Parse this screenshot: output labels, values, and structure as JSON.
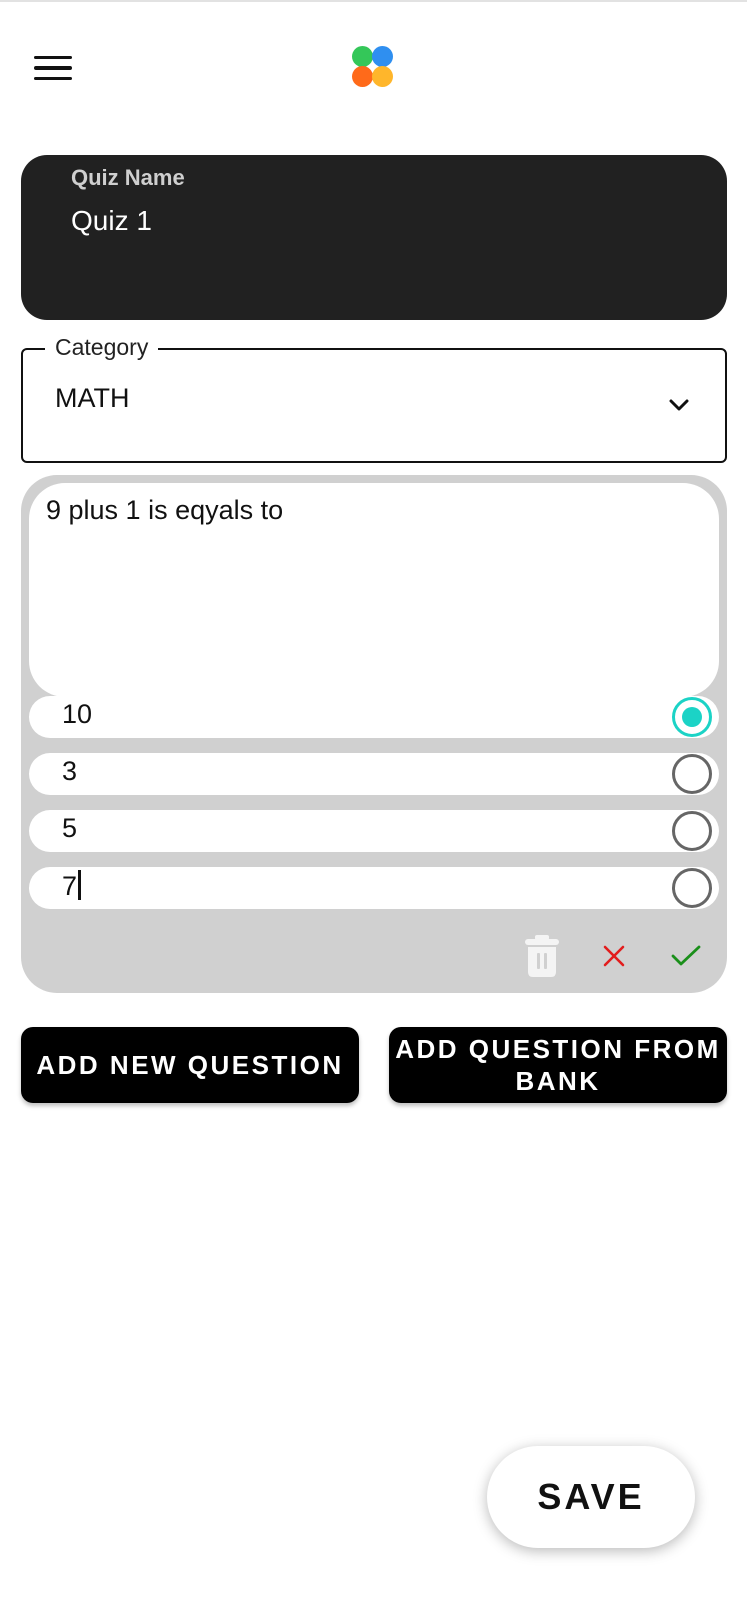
{
  "header": {
    "menu_icon": "hamburger-menu-icon",
    "logo_icon": "four-dot-logo-icon"
  },
  "quiz_name": {
    "label": "Quiz Name",
    "value": "Quiz 1"
  },
  "category": {
    "label": "Category",
    "selected": "MATH"
  },
  "question": {
    "text": "9 plus 1 is eqyals to",
    "options": [
      {
        "text": "10",
        "selected": true
      },
      {
        "text": "3",
        "selected": false
      },
      {
        "text": "5",
        "selected": false
      },
      {
        "text": "7",
        "selected": false
      }
    ],
    "actions": {
      "delete_icon": "trash-icon",
      "cancel_icon": "close-icon",
      "confirm_icon": "check-icon"
    }
  },
  "buttons": {
    "add_new_question": "ADD NEW QUESTION",
    "add_from_bank": "ADD QUESTION FROM BANK",
    "save": "SAVE"
  },
  "colors": {
    "accent": "#1bd3c6",
    "cancel": "#e21d1d",
    "confirm": "#1a8f1a",
    "dark_card": "#212121"
  }
}
